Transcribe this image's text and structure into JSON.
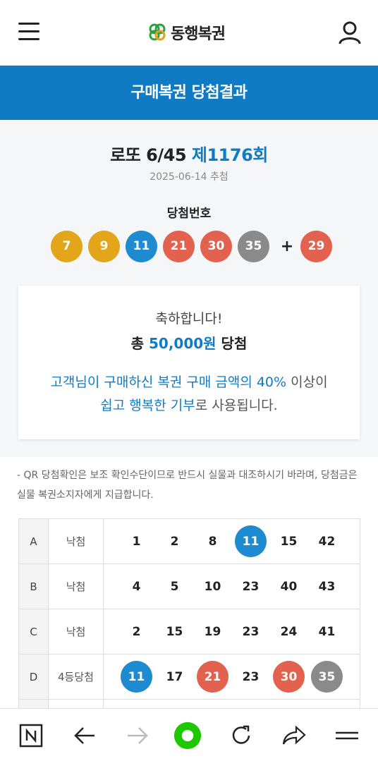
{
  "header": {
    "logo_text": "동행복권"
  },
  "banner": {
    "title": "구매복권 당첨결과"
  },
  "draw": {
    "game": "로또 6/45",
    "round": "제1176회",
    "date": "2025-06-14 추첨",
    "winning_label": "당첨번호",
    "winning_numbers": [
      {
        "n": "7",
        "color": "#e3a61b"
      },
      {
        "n": "9",
        "color": "#e3a61b"
      },
      {
        "n": "11",
        "color": "#1e8bd1"
      },
      {
        "n": "21",
        "color": "#e3624f"
      },
      {
        "n": "30",
        "color": "#e3624f"
      },
      {
        "n": "35",
        "color": "#8a8a8a"
      }
    ],
    "plus": "+",
    "bonus": {
      "n": "29",
      "color": "#e3624f"
    }
  },
  "congrats": {
    "line1": "축하합니다!",
    "prefix": "총",
    "amount": "50,000원",
    "suffix": "당첨",
    "line3_blue": "고객님이 구매하신 복권 구매 금액의 40%",
    "line3_gray": " 이상이",
    "line4_blue": "쉽고 행복한 기부",
    "line4_gray": "로 사용됩니다."
  },
  "notice": "- QR 당첨확인은 보조 확인수단이므로 반드시 실물과 대조하시기 바라며, 당첨금은 실물 복권소지자에게 지급합니다.",
  "tickets": [
    {
      "letter": "A",
      "status": "낙첨",
      "nums": [
        [
          "1",
          ""
        ],
        [
          "2",
          ""
        ],
        [
          "8",
          ""
        ],
        [
          "11",
          "b"
        ],
        [
          "15",
          ""
        ],
        [
          "42",
          ""
        ]
      ]
    },
    {
      "letter": "B",
      "status": "낙첨",
      "nums": [
        [
          "4",
          ""
        ],
        [
          "5",
          ""
        ],
        [
          "10",
          ""
        ],
        [
          "23",
          ""
        ],
        [
          "40",
          ""
        ],
        [
          "43",
          ""
        ]
      ]
    },
    {
      "letter": "C",
      "status": "낙첨",
      "nums": [
        [
          "2",
          ""
        ],
        [
          "15",
          ""
        ],
        [
          "19",
          ""
        ],
        [
          "23",
          ""
        ],
        [
          "24",
          ""
        ],
        [
          "41",
          ""
        ]
      ]
    },
    {
      "letter": "D",
      "status": "4등당첨",
      "nums": [
        [
          "11",
          "b"
        ],
        [
          "17",
          ""
        ],
        [
          "21",
          "r"
        ],
        [
          "23",
          ""
        ],
        [
          "30",
          "r"
        ],
        [
          "35",
          "g"
        ]
      ]
    }
  ],
  "colors": {
    "brand_blue": "#0f7bc5",
    "ball_yellow": "#e3a61b",
    "ball_blue": "#1e8bd1",
    "ball_red": "#e3624f",
    "ball_gray": "#8a8a8a",
    "nav_green": "#1ec800"
  }
}
